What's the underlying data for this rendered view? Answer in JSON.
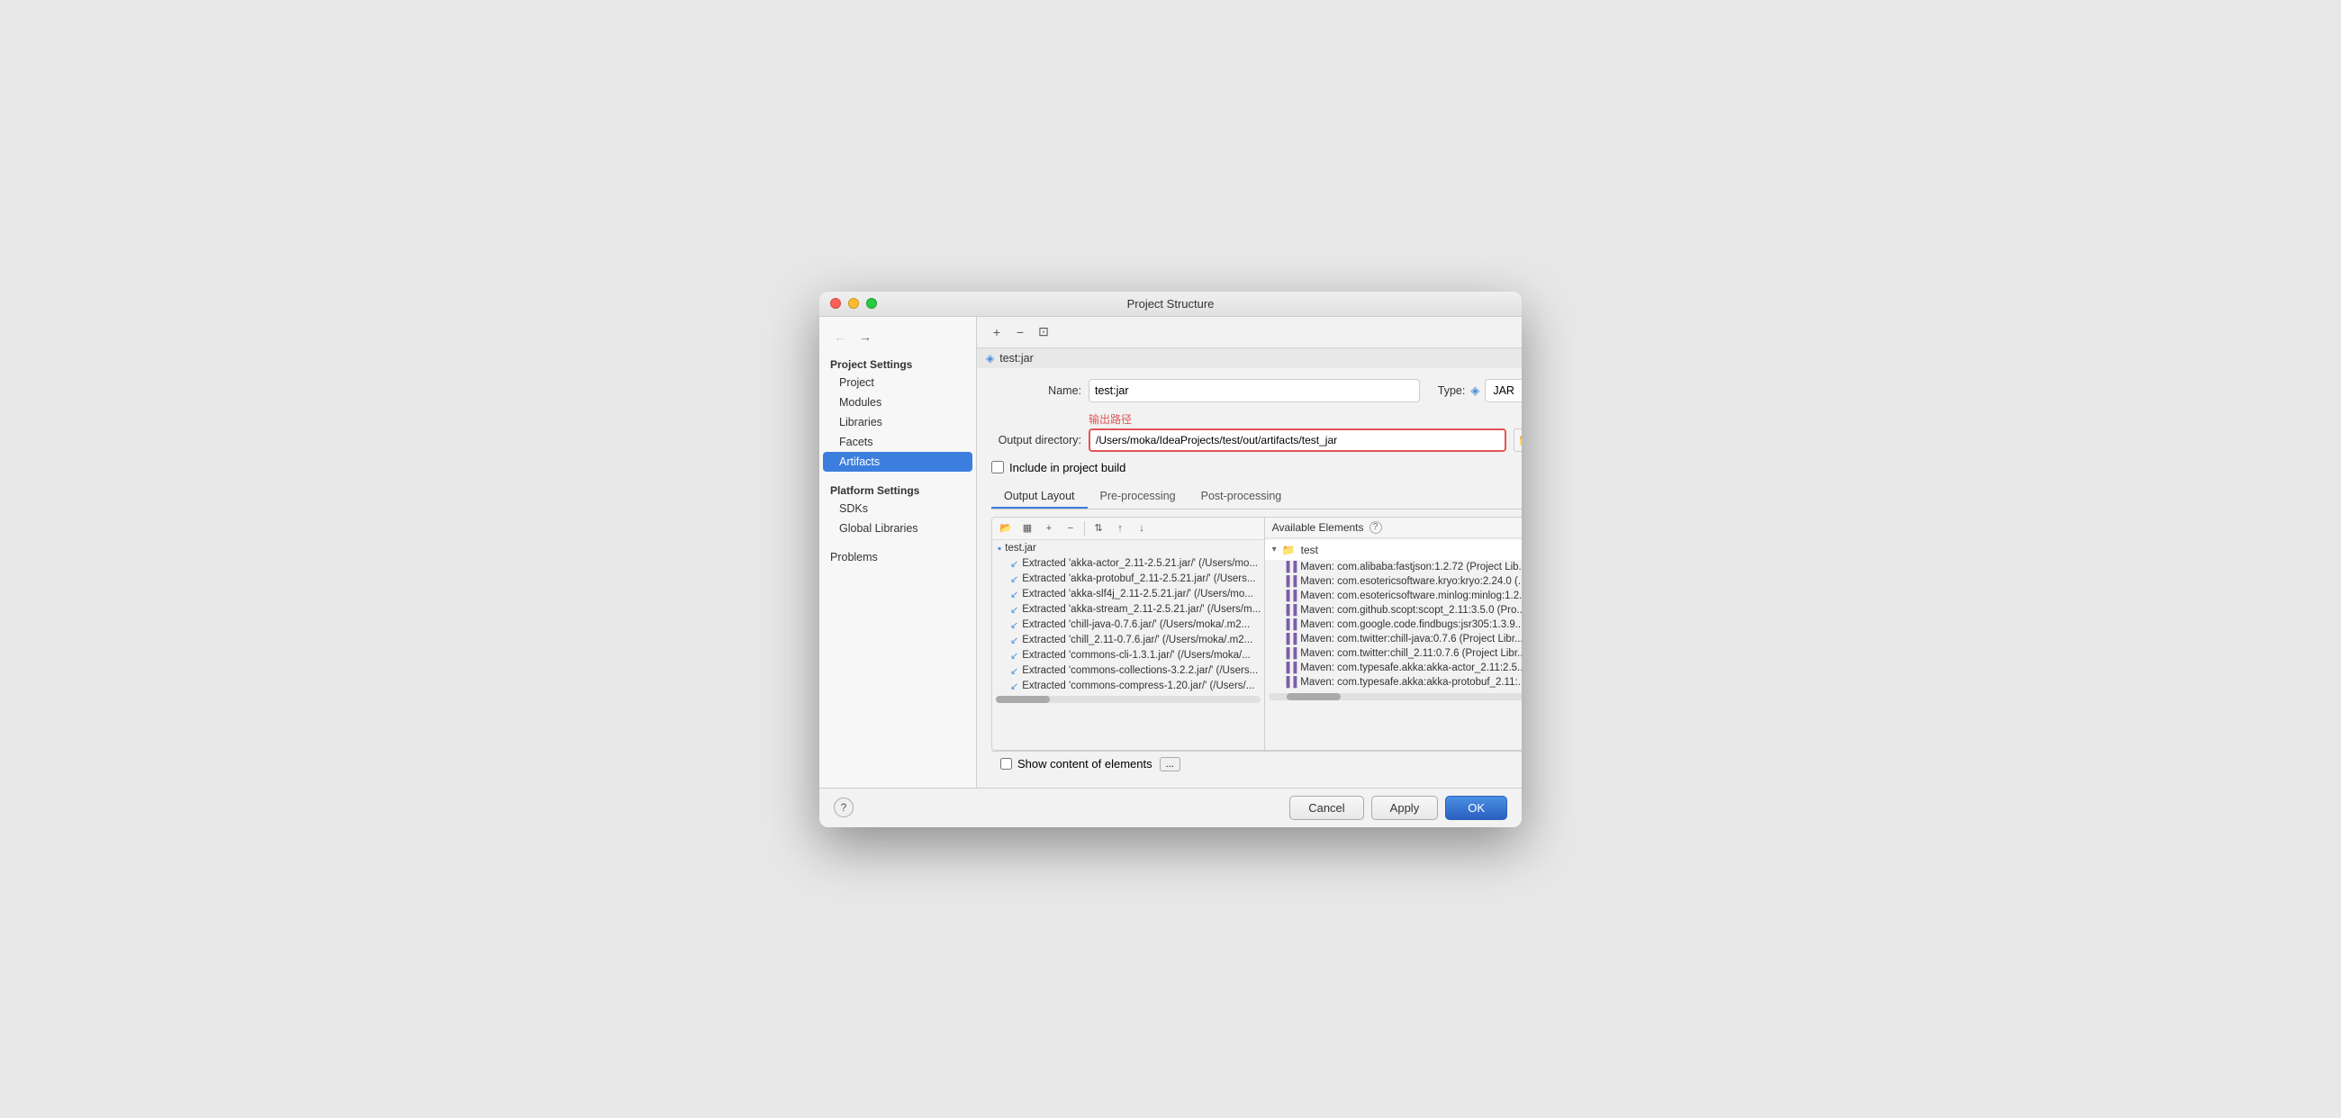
{
  "window": {
    "title": "Project Structure",
    "controls": {
      "close": "close",
      "minimize": "minimize",
      "maximize": "maximize"
    }
  },
  "navigation": {
    "back_label": "←",
    "forward_label": "→"
  },
  "sidebar": {
    "project_settings_label": "Project Settings",
    "items": [
      {
        "id": "project",
        "label": "Project"
      },
      {
        "id": "modules",
        "label": "Modules"
      },
      {
        "id": "libraries",
        "label": "Libraries"
      },
      {
        "id": "facets",
        "label": "Facets"
      },
      {
        "id": "artifacts",
        "label": "Artifacts",
        "active": true
      }
    ],
    "platform_settings_label": "Platform Settings",
    "platform_items": [
      {
        "id": "sdks",
        "label": "SDKs"
      },
      {
        "id": "global-libraries",
        "label": "Global Libraries"
      }
    ],
    "problems_label": "Problems"
  },
  "artifacts_toolbar": {
    "add_label": "+",
    "remove_label": "−",
    "copy_label": "⊡"
  },
  "artifact_list": {
    "item_icon": "jar",
    "item_label": "test:jar"
  },
  "detail": {
    "name_label": "Name:",
    "name_value": "test:jar",
    "type_label": "Type:",
    "type_value": "JAR",
    "type_icon": "◈",
    "output_dir_label": "Output directory:",
    "output_dir_value": "/Users/moka/IdeaProjects/test/out/artifacts/test_jar",
    "annotation_label": "输出路径",
    "include_label": "Include in project build",
    "tabs": [
      {
        "id": "output-layout",
        "label": "Output Layout",
        "active": true
      },
      {
        "id": "pre-processing",
        "label": "Pre-processing"
      },
      {
        "id": "post-processing",
        "label": "Post-processing"
      }
    ]
  },
  "left_pane": {
    "tree_items": [
      {
        "level": 0,
        "icon": "jar",
        "label": "test.jar"
      },
      {
        "level": 1,
        "icon": "lib",
        "label": "Extracted 'akka-actor_2.11-2.5.21.jar/' (/Users/mo..."
      },
      {
        "level": 1,
        "icon": "lib",
        "label": "Extracted 'akka-protobuf_2.11-2.5.21.jar/' (/Users..."
      },
      {
        "level": 1,
        "icon": "lib",
        "label": "Extracted 'akka-slf4j_2.11-2.5.21.jar/' (/Users/mo..."
      },
      {
        "level": 1,
        "icon": "lib",
        "label": "Extracted 'akka-stream_2.11-2.5.21.jar/' (/Users/m..."
      },
      {
        "level": 1,
        "icon": "lib",
        "label": "Extracted 'chill-java-0.7.6.jar/' (/Users/moka/.m2..."
      },
      {
        "level": 1,
        "icon": "lib",
        "label": "Extracted 'chill_2.11-0.7.6.jar/' (/Users/moka/.m2..."
      },
      {
        "level": 1,
        "icon": "lib",
        "label": "Extracted 'commons-cli-1.3.1.jar/' (/Users/moka/..."
      },
      {
        "level": 1,
        "icon": "lib",
        "label": "Extracted 'commons-collections-3.2.2.jar/' (/Users..."
      },
      {
        "level": 1,
        "icon": "lib",
        "label": "Extracted 'commons-compress-1.20.jar/' (/Users/..."
      }
    ]
  },
  "right_pane": {
    "header_expand": "▾",
    "header_icon": "folder",
    "header_label": "test",
    "items": [
      {
        "icon": "maven",
        "label": "Maven: com.alibaba:fastjson:1.2.72 (Project Lib..."
      },
      {
        "icon": "maven",
        "label": "Maven: com.esotericsoftware.kryo:kryo:2.24.0 (..."
      },
      {
        "icon": "maven",
        "label": "Maven: com.esotericsoftware.minlog:minlog:1.2..."
      },
      {
        "icon": "maven",
        "label": "Maven: com.github.scopt:scopt_2.11:3.5.0 (Pro..."
      },
      {
        "icon": "maven",
        "label": "Maven: com.google.code.findbugs:jsr305:1.3.9..."
      },
      {
        "icon": "maven",
        "label": "Maven: com.twitter:chill-java:0.7.6 (Project Libr..."
      },
      {
        "icon": "maven",
        "label": "Maven: com.twitter:chill_2.11:0.7.6 (Project Libr..."
      },
      {
        "icon": "maven",
        "label": "Maven: com.typesafe.akka:akka-actor_2.11:2.5...."
      },
      {
        "icon": "maven",
        "label": "Maven: com.typesafe.akka:akka-protobuf_2.11:..."
      }
    ],
    "available_elements_label": "Available Elements",
    "help_icon": "?"
  },
  "bottom_bar": {
    "show_content_label": "Show content of elements",
    "ellipsis_label": "..."
  },
  "footer": {
    "help_label": "?",
    "cancel_label": "Cancel",
    "apply_label": "Apply",
    "ok_label": "OK"
  }
}
